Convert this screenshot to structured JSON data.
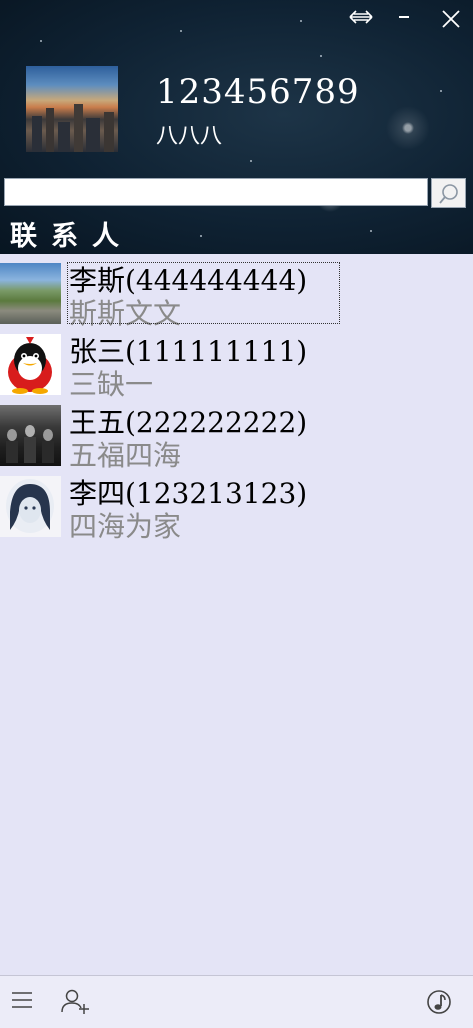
{
  "window": {
    "buttons": [
      "restore-icon",
      "minimize-icon",
      "close-icon"
    ]
  },
  "profile": {
    "account": "123456789",
    "signature": "八八八"
  },
  "search": {
    "value": "",
    "placeholder": ""
  },
  "tabs": {
    "contacts_label": "联系人"
  },
  "contacts": [
    {
      "name": "李斯(444444444)",
      "signature": "斯斯文文",
      "avatar": "landscape-photo"
    },
    {
      "name": "张三(111111111)",
      "signature": "三缺一",
      "avatar": "penguin-logo"
    },
    {
      "name": "王五(222222222)",
      "signature": "五福四海",
      "avatar": "group-photo"
    },
    {
      "name": "李四(123213123)",
      "signature": "四海为家",
      "avatar": "girl-portrait"
    }
  ],
  "footer": {
    "icons": [
      "menu-icon",
      "add-contact-icon",
      "music-icon"
    ]
  },
  "colors": {
    "list_bg": "#e4e4f6",
    "signature_text": "#8a8a8a",
    "header_bg": "#0f2233"
  }
}
